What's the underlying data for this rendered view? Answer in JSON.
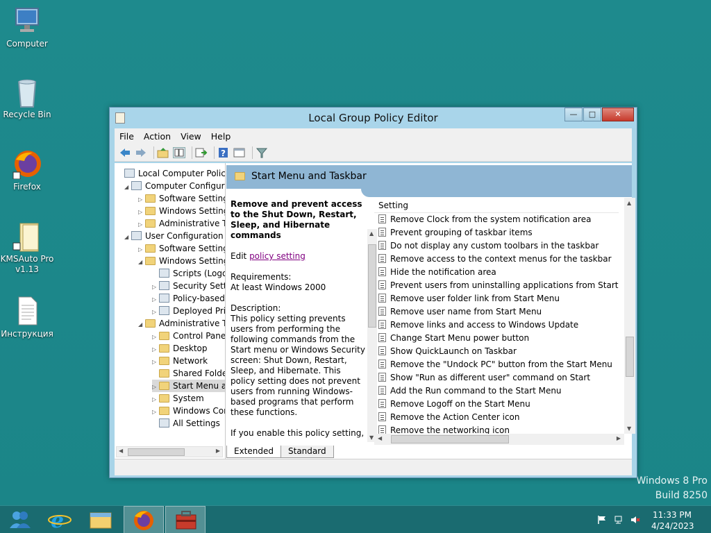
{
  "desktop": {
    "icons": [
      {
        "label": "Computer"
      },
      {
        "label": "Recycle Bin"
      },
      {
        "label": "Firefox"
      },
      {
        "label": "KMSAuto Pro v1.13"
      },
      {
        "label": "Инструкция"
      }
    ],
    "watermark": {
      "line1": "Windows 8 Pro",
      "line2": "Build 8250"
    }
  },
  "window": {
    "title": "Local Group Policy Editor",
    "buttons": {
      "minimize": "—",
      "maximize": "□",
      "close": "✕"
    },
    "menu": [
      "File",
      "Action",
      "View",
      "Help"
    ],
    "toolbar_icons": [
      "back-icon",
      "forward-icon",
      "up-folder-icon",
      "show-hide-tree-icon",
      "export-list-icon",
      "help-icon",
      "properties-icon",
      "filter-icon"
    ]
  },
  "tree": {
    "items": [
      {
        "label": "Local Computer Policy",
        "level": 0,
        "expander": "",
        "icon": "policy"
      },
      {
        "label": "Computer Configura",
        "level": 1,
        "expander": "◢",
        "icon": "computer"
      },
      {
        "label": "Software Settings",
        "level": 2,
        "expander": "▷",
        "icon": "folder"
      },
      {
        "label": "Windows Setting",
        "level": 2,
        "expander": "▷",
        "icon": "folder"
      },
      {
        "label": "Administrative Te",
        "level": 2,
        "expander": "▷",
        "icon": "folder"
      },
      {
        "label": "User Configuration",
        "level": 1,
        "expander": "◢",
        "icon": "users"
      },
      {
        "label": "Software Settings",
        "level": 2,
        "expander": "▷",
        "icon": "folder"
      },
      {
        "label": "Windows Setting",
        "level": 2,
        "expander": "◢",
        "icon": "folder"
      },
      {
        "label": "Scripts (Logor",
        "level": 3,
        "expander": "",
        "icon": "doc"
      },
      {
        "label": "Security Settin",
        "level": 3,
        "expander": "▷",
        "icon": "doc"
      },
      {
        "label": "Policy-based",
        "level": 3,
        "expander": "▷",
        "icon": "chart"
      },
      {
        "label": "Deployed Prir",
        "level": 3,
        "expander": "▷",
        "icon": "printer"
      },
      {
        "label": "Administrative Te",
        "level": 2,
        "expander": "◢",
        "icon": "folder"
      },
      {
        "label": "Control Panel",
        "level": 3,
        "expander": "▷",
        "icon": "folder"
      },
      {
        "label": "Desktop",
        "level": 3,
        "expander": "▷",
        "icon": "folder"
      },
      {
        "label": "Network",
        "level": 3,
        "expander": "▷",
        "icon": "folder"
      },
      {
        "label": "Shared Folder",
        "level": 3,
        "expander": "",
        "icon": "folder"
      },
      {
        "label": "Start Menu ar",
        "level": 3,
        "expander": "▷",
        "icon": "folder",
        "selected": true
      },
      {
        "label": "System",
        "level": 3,
        "expander": "▷",
        "icon": "folder"
      },
      {
        "label": "Windows Cor",
        "level": 3,
        "expander": "▷",
        "icon": "folder"
      },
      {
        "label": "All Settings",
        "level": 3,
        "expander": "",
        "icon": "settings"
      }
    ]
  },
  "pane": {
    "header": "Start Menu and Taskbar",
    "description": {
      "title": "Remove and prevent access to the Shut Down, Restart, Sleep, and Hibernate commands",
      "edit_prefix": "Edit ",
      "edit_link": "policy setting",
      "requirements_label": "Requirements:",
      "requirements_value": "At least Windows 2000",
      "description_label": "Description:",
      "description_text": "This policy setting prevents users from performing the following commands from the Start menu or Windows Security screen: Shut Down, Restart, Sleep, and Hibernate. This policy setting does not prevent users from running Windows-based programs that perform these functions.",
      "enable_text": "If you enable this policy setting, the Power button and the Shut Down, Restart, Sleep, and Hibernate commands"
    },
    "column_header": "Setting",
    "settings": [
      "Remove Clock from the system notification area",
      "Prevent grouping of taskbar items",
      "Do not display any custom toolbars in the taskbar",
      "Remove access to the context menus for the taskbar",
      "Hide the notification area",
      "Prevent users from uninstalling applications from Start",
      "Remove user folder link from Start Menu",
      "Remove user name from Start Menu",
      "Remove links and access to Windows Update",
      "Change Start Menu power button",
      "Show QuickLaunch on Taskbar",
      "Remove the \"Undock PC\" button from the Start Menu",
      "Show \"Run as different user\" command on Start",
      "Add the Run command to the Start Menu",
      "Remove Logoff on the Start Menu",
      "Remove the Action Center icon",
      "Remove the networking icon"
    ],
    "tabs": [
      "Extended",
      "Standard"
    ]
  },
  "taskbar": {
    "buttons": [
      "users-icon",
      "internet-explorer-icon",
      "file-explorer-icon",
      "firefox-icon",
      "toolbox-icon"
    ],
    "clock": {
      "time": "11:33 PM",
      "date": "4/24/2023"
    }
  },
  "colors": {
    "desktop": "#1e8a8d",
    "taskbar": "#1a6b70",
    "titlebar": "#a9d5ea",
    "header": "#8fb6d4"
  }
}
